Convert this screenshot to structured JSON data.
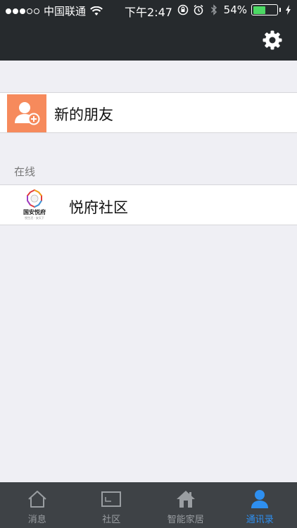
{
  "status_bar": {
    "carrier": "中国联通",
    "time": "下午2:47",
    "battery_percent": "54%",
    "battery_level": 0.54,
    "signal_bars_filled": 3,
    "signal_bars_total": 5,
    "icons": [
      "wifi-icon",
      "rotation-lock-icon",
      "alarm-icon",
      "bluetooth-icon",
      "charging-icon"
    ]
  },
  "nav": {
    "right_icon": "settings-icon"
  },
  "contacts": {
    "new_friends_label": "新的朋友",
    "section_online": "在线",
    "community_name": "悦府社区",
    "community_logo_text": "国安悦府",
    "community_logo_sub": "悦生活 · 安天下"
  },
  "tabbar": {
    "active": 3,
    "tabs": [
      {
        "label": "消息",
        "icon": "home-outline-icon"
      },
      {
        "label": "社区",
        "icon": "card-icon"
      },
      {
        "label": "智能家居",
        "icon": "house-icon"
      },
      {
        "label": "通讯录",
        "icon": "person-icon"
      }
    ]
  },
  "colors": {
    "nav_bg": "#262a2d",
    "page_bg": "#efeff4",
    "new_friend_bg": "#f68a5c",
    "tab_active": "#2e8ff0",
    "tab_inactive": "#9a9ea2",
    "battery_fill": "#4cd964"
  }
}
